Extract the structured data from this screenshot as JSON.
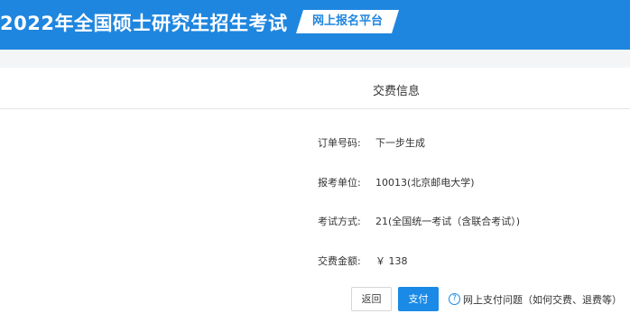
{
  "header": {
    "title": "2022年全国硕士研究生招生考试",
    "badge": "网上报名平台",
    "colors": {
      "brand": "#1f86df",
      "badge_bg": "#ffffff"
    }
  },
  "section": {
    "title": "交费信息"
  },
  "fields": [
    {
      "label": "订单号码:",
      "value": "下一步生成"
    },
    {
      "label": "报考单位:",
      "value": "10013(北京邮电大学)"
    },
    {
      "label": "考试方式:",
      "value": "21(全国统一考试（含联合考试）)"
    },
    {
      "label": "交费金额:",
      "value": "￥  138"
    }
  ],
  "actions": {
    "back_label": "返回",
    "pay_label": "支付",
    "help_label": "网上支付问题（如何交费、退费等）",
    "help_icon": "question-circle-icon",
    "pay_color": "#1a8ae6"
  }
}
